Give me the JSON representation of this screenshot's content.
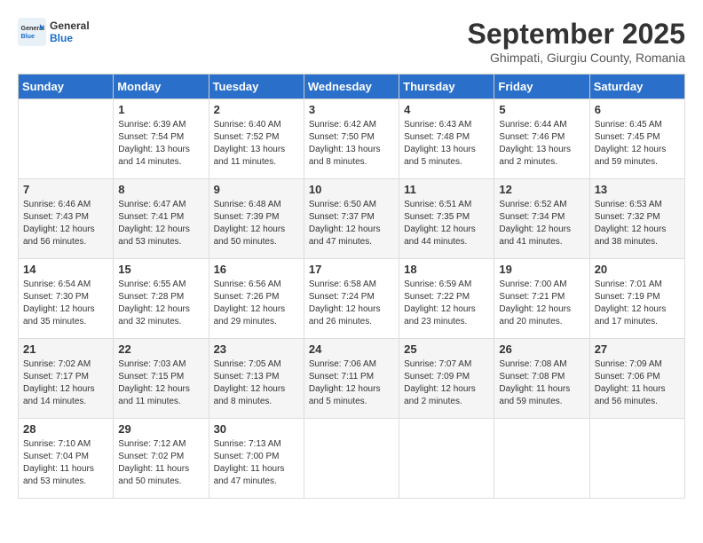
{
  "header": {
    "logo_general": "General",
    "logo_blue": "Blue",
    "month_title": "September 2025",
    "location": "Ghimpati, Giurgiu County, Romania"
  },
  "weekdays": [
    "Sunday",
    "Monday",
    "Tuesday",
    "Wednesday",
    "Thursday",
    "Friday",
    "Saturday"
  ],
  "weeks": [
    [
      {
        "day": "",
        "sunrise": "",
        "sunset": "",
        "daylight": ""
      },
      {
        "day": "1",
        "sunrise": "Sunrise: 6:39 AM",
        "sunset": "Sunset: 7:54 PM",
        "daylight": "Daylight: 13 hours and 14 minutes."
      },
      {
        "day": "2",
        "sunrise": "Sunrise: 6:40 AM",
        "sunset": "Sunset: 7:52 PM",
        "daylight": "Daylight: 13 hours and 11 minutes."
      },
      {
        "day": "3",
        "sunrise": "Sunrise: 6:42 AM",
        "sunset": "Sunset: 7:50 PM",
        "daylight": "Daylight: 13 hours and 8 minutes."
      },
      {
        "day": "4",
        "sunrise": "Sunrise: 6:43 AM",
        "sunset": "Sunset: 7:48 PM",
        "daylight": "Daylight: 13 hours and 5 minutes."
      },
      {
        "day": "5",
        "sunrise": "Sunrise: 6:44 AM",
        "sunset": "Sunset: 7:46 PM",
        "daylight": "Daylight: 13 hours and 2 minutes."
      },
      {
        "day": "6",
        "sunrise": "Sunrise: 6:45 AM",
        "sunset": "Sunset: 7:45 PM",
        "daylight": "Daylight: 12 hours and 59 minutes."
      }
    ],
    [
      {
        "day": "7",
        "sunrise": "Sunrise: 6:46 AM",
        "sunset": "Sunset: 7:43 PM",
        "daylight": "Daylight: 12 hours and 56 minutes."
      },
      {
        "day": "8",
        "sunrise": "Sunrise: 6:47 AM",
        "sunset": "Sunset: 7:41 PM",
        "daylight": "Daylight: 12 hours and 53 minutes."
      },
      {
        "day": "9",
        "sunrise": "Sunrise: 6:48 AM",
        "sunset": "Sunset: 7:39 PM",
        "daylight": "Daylight: 12 hours and 50 minutes."
      },
      {
        "day": "10",
        "sunrise": "Sunrise: 6:50 AM",
        "sunset": "Sunset: 7:37 PM",
        "daylight": "Daylight: 12 hours and 47 minutes."
      },
      {
        "day": "11",
        "sunrise": "Sunrise: 6:51 AM",
        "sunset": "Sunset: 7:35 PM",
        "daylight": "Daylight: 12 hours and 44 minutes."
      },
      {
        "day": "12",
        "sunrise": "Sunrise: 6:52 AM",
        "sunset": "Sunset: 7:34 PM",
        "daylight": "Daylight: 12 hours and 41 minutes."
      },
      {
        "day": "13",
        "sunrise": "Sunrise: 6:53 AM",
        "sunset": "Sunset: 7:32 PM",
        "daylight": "Daylight: 12 hours and 38 minutes."
      }
    ],
    [
      {
        "day": "14",
        "sunrise": "Sunrise: 6:54 AM",
        "sunset": "Sunset: 7:30 PM",
        "daylight": "Daylight: 12 hours and 35 minutes."
      },
      {
        "day": "15",
        "sunrise": "Sunrise: 6:55 AM",
        "sunset": "Sunset: 7:28 PM",
        "daylight": "Daylight: 12 hours and 32 minutes."
      },
      {
        "day": "16",
        "sunrise": "Sunrise: 6:56 AM",
        "sunset": "Sunset: 7:26 PM",
        "daylight": "Daylight: 12 hours and 29 minutes."
      },
      {
        "day": "17",
        "sunrise": "Sunrise: 6:58 AM",
        "sunset": "Sunset: 7:24 PM",
        "daylight": "Daylight: 12 hours and 26 minutes."
      },
      {
        "day": "18",
        "sunrise": "Sunrise: 6:59 AM",
        "sunset": "Sunset: 7:22 PM",
        "daylight": "Daylight: 12 hours and 23 minutes."
      },
      {
        "day": "19",
        "sunrise": "Sunrise: 7:00 AM",
        "sunset": "Sunset: 7:21 PM",
        "daylight": "Daylight: 12 hours and 20 minutes."
      },
      {
        "day": "20",
        "sunrise": "Sunrise: 7:01 AM",
        "sunset": "Sunset: 7:19 PM",
        "daylight": "Daylight: 12 hours and 17 minutes."
      }
    ],
    [
      {
        "day": "21",
        "sunrise": "Sunrise: 7:02 AM",
        "sunset": "Sunset: 7:17 PM",
        "daylight": "Daylight: 12 hours and 14 minutes."
      },
      {
        "day": "22",
        "sunrise": "Sunrise: 7:03 AM",
        "sunset": "Sunset: 7:15 PM",
        "daylight": "Daylight: 12 hours and 11 minutes."
      },
      {
        "day": "23",
        "sunrise": "Sunrise: 7:05 AM",
        "sunset": "Sunset: 7:13 PM",
        "daylight": "Daylight: 12 hours and 8 minutes."
      },
      {
        "day": "24",
        "sunrise": "Sunrise: 7:06 AM",
        "sunset": "Sunset: 7:11 PM",
        "daylight": "Daylight: 12 hours and 5 minutes."
      },
      {
        "day": "25",
        "sunrise": "Sunrise: 7:07 AM",
        "sunset": "Sunset: 7:09 PM",
        "daylight": "Daylight: 12 hours and 2 minutes."
      },
      {
        "day": "26",
        "sunrise": "Sunrise: 7:08 AM",
        "sunset": "Sunset: 7:08 PM",
        "daylight": "Daylight: 11 hours and 59 minutes."
      },
      {
        "day": "27",
        "sunrise": "Sunrise: 7:09 AM",
        "sunset": "Sunset: 7:06 PM",
        "daylight": "Daylight: 11 hours and 56 minutes."
      }
    ],
    [
      {
        "day": "28",
        "sunrise": "Sunrise: 7:10 AM",
        "sunset": "Sunset: 7:04 PM",
        "daylight": "Daylight: 11 hours and 53 minutes."
      },
      {
        "day": "29",
        "sunrise": "Sunrise: 7:12 AM",
        "sunset": "Sunset: 7:02 PM",
        "daylight": "Daylight: 11 hours and 50 minutes."
      },
      {
        "day": "30",
        "sunrise": "Sunrise: 7:13 AM",
        "sunset": "Sunset: 7:00 PM",
        "daylight": "Daylight: 11 hours and 47 minutes."
      },
      {
        "day": "",
        "sunrise": "",
        "sunset": "",
        "daylight": ""
      },
      {
        "day": "",
        "sunrise": "",
        "sunset": "",
        "daylight": ""
      },
      {
        "day": "",
        "sunrise": "",
        "sunset": "",
        "daylight": ""
      },
      {
        "day": "",
        "sunrise": "",
        "sunset": "",
        "daylight": ""
      }
    ]
  ]
}
